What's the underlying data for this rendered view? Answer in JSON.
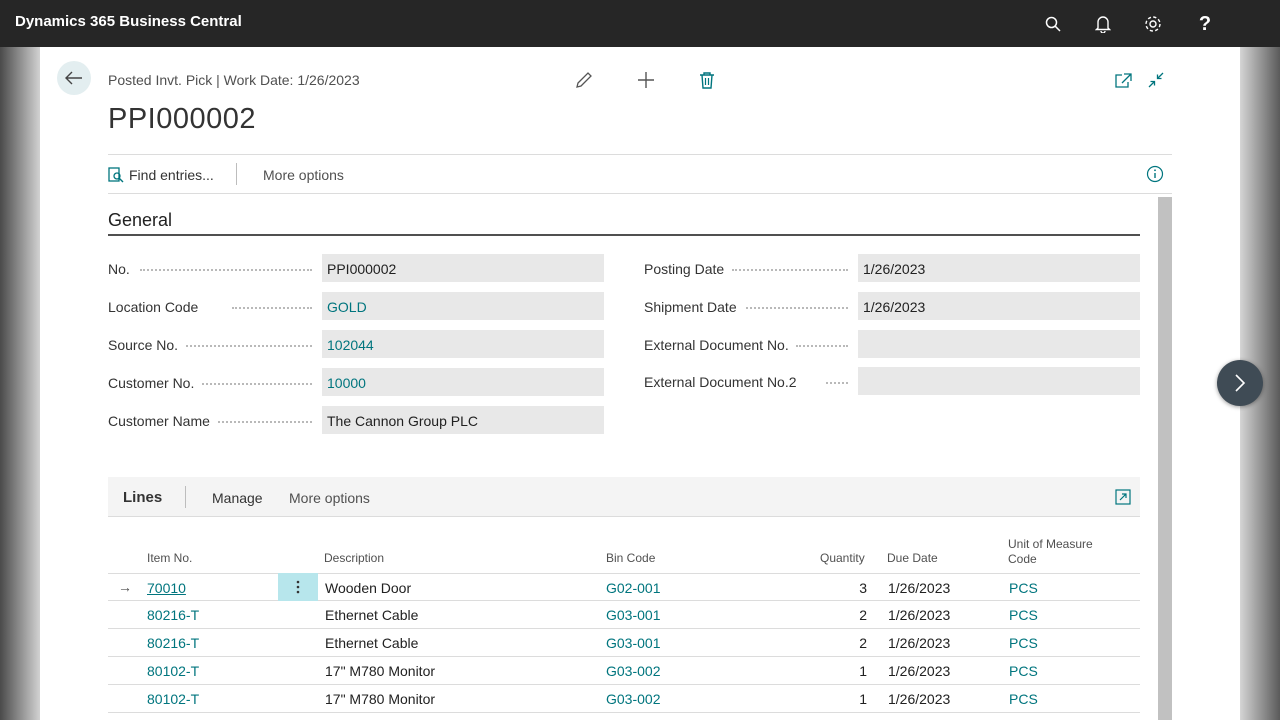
{
  "app": {
    "title": "Dynamics 365 Business Central"
  },
  "topbar": {
    "icons": [
      "search-icon",
      "bell-icon",
      "gear-icon",
      "help-icon"
    ]
  },
  "header": {
    "caption": "Posted Invt. Pick | Work Date: 1/26/2023",
    "title": "PPI000002"
  },
  "actionbar": {
    "find": "Find entries...",
    "more": "More options"
  },
  "general": {
    "title": "General",
    "left": [
      {
        "label": "No.",
        "value": "PPI000002",
        "link": false
      },
      {
        "label": "Location Code",
        "value": "GOLD",
        "link": true
      },
      {
        "label": "Source No.",
        "value": "102044",
        "link": true
      },
      {
        "label": "Customer No.",
        "value": "10000",
        "link": true
      },
      {
        "label": "Customer Name",
        "value": "The Cannon Group PLC",
        "link": false
      }
    ],
    "right": [
      {
        "label": "Posting Date",
        "value": "1/26/2023"
      },
      {
        "label": "Shipment Date",
        "value": "1/26/2023"
      },
      {
        "label": "External Document No.",
        "value": ""
      },
      {
        "label": "External Document No.2",
        "value": ""
      }
    ]
  },
  "lines": {
    "title": "Lines",
    "manage": "Manage",
    "more": "More options",
    "columns": {
      "item_no": "Item No.",
      "description": "Description",
      "bin_code": "Bin Code",
      "quantity": "Quantity",
      "due_date": "Due Date",
      "uom_1": "Unit of Measure",
      "uom_2": "Code"
    },
    "rows": [
      {
        "item_no": "70010",
        "description": "Wooden Door",
        "bin_code": "G02-001",
        "quantity": "3",
        "due_date": "1/26/2023",
        "uom": "PCS"
      },
      {
        "item_no": "80216-T",
        "description": "Ethernet Cable",
        "bin_code": "G03-001",
        "quantity": "2",
        "due_date": "1/26/2023",
        "uom": "PCS"
      },
      {
        "item_no": "80216-T",
        "description": "Ethernet Cable",
        "bin_code": "G03-001",
        "quantity": "2",
        "due_date": "1/26/2023",
        "uom": "PCS"
      },
      {
        "item_no": "80102-T",
        "description": "17\" M780 Monitor",
        "bin_code": "G03-002",
        "quantity": "1",
        "due_date": "1/26/2023",
        "uom": "PCS"
      },
      {
        "item_no": "80102-T",
        "description": "17\" M780 Monitor",
        "bin_code": "G03-002",
        "quantity": "1",
        "due_date": "1/26/2023",
        "uom": "PCS"
      }
    ]
  },
  "colors": {
    "accent": "#00757e",
    "topbar": "#262626"
  }
}
